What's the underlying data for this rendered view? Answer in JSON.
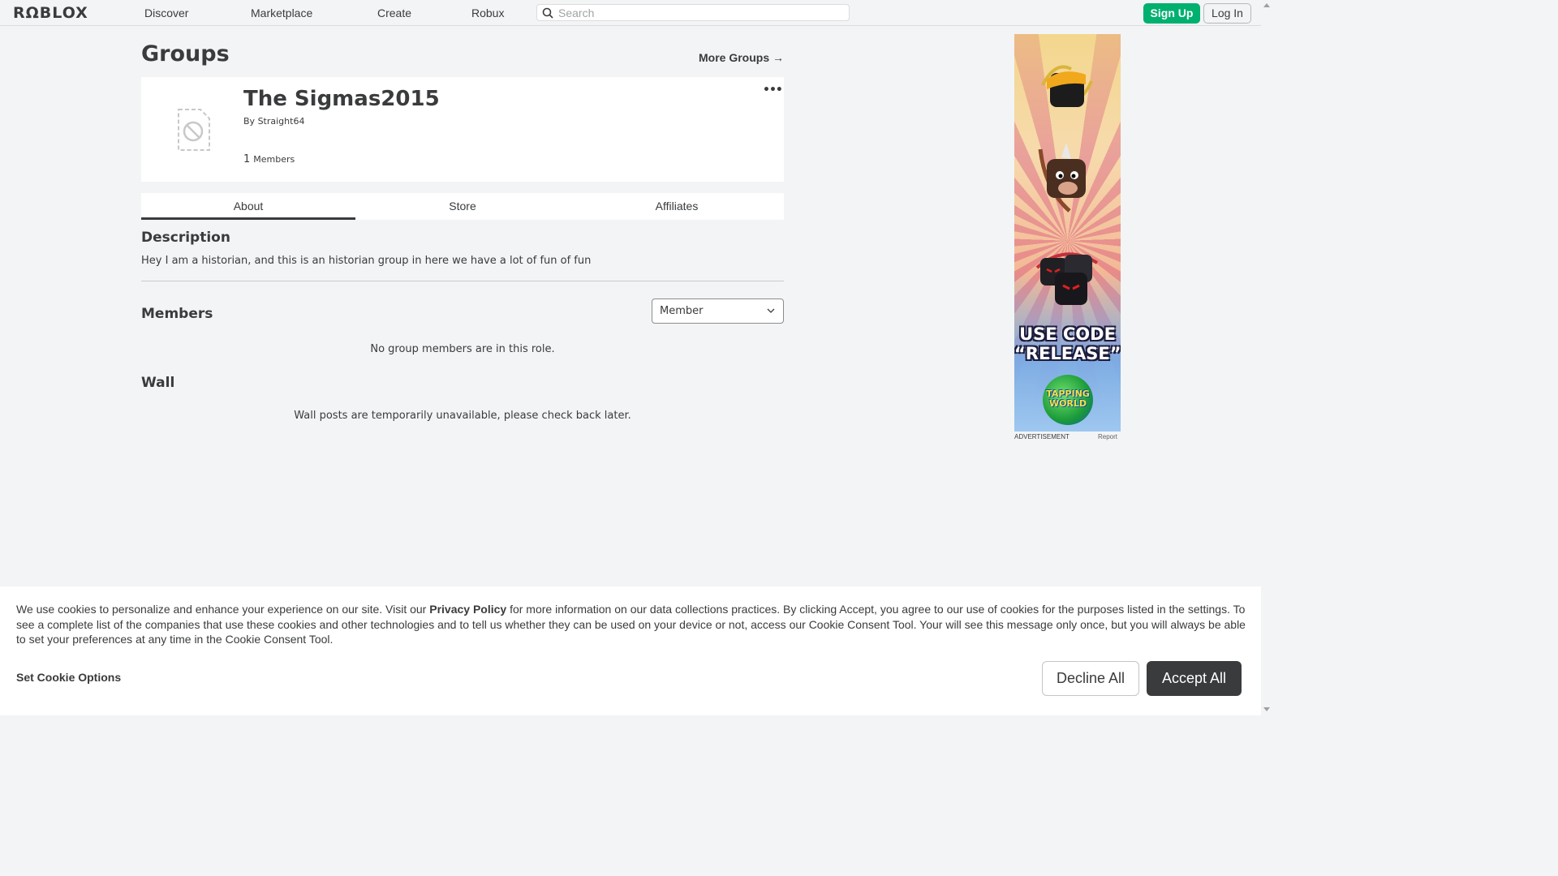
{
  "nav": {
    "logo": "RΩBLOX",
    "links": [
      "Discover",
      "Marketplace",
      "Create",
      "Robux"
    ],
    "search_placeholder": "Search",
    "signup": "Sign Up",
    "login": "Log In"
  },
  "page": {
    "title": "Groups",
    "more_groups": "More Groups →"
  },
  "group": {
    "name": "The Sigmas2015",
    "by_label": "By",
    "owner": "Straight64",
    "member_count": "1",
    "members_label": "Members",
    "more_icon": "ellipsis-icon"
  },
  "tabs": [
    "About",
    "Store",
    "Affiliates"
  ],
  "active_tab": "About",
  "description": {
    "heading": "Description",
    "text": "Hey I am a historian, and this is an historian group in here we have a lot of fun of fun"
  },
  "members": {
    "heading": "Members",
    "role_selected": "Member",
    "empty": "No group members are in this role."
  },
  "wall": {
    "heading": "Wall",
    "empty": "Wall posts are temporarily unavailable, please check back later."
  },
  "ad": {
    "headline_1": "USE CODE",
    "headline_2": "“RELEASE”",
    "logo_text_1": "TAPPING",
    "logo_text_2": "WORLD",
    "label": "ADVERTISEMENT",
    "report": "Report"
  },
  "cookie": {
    "text_1": "We use cookies to personalize and enhance your experience on our site. Visit our ",
    "privacy_link": "Privacy Policy",
    "text_2": " for more information on our data collections practices. By clicking Accept, you agree to our use of cookies for the purposes listed in the settings. To see a complete list of the companies that use these cookies and other technologies and to tell us whether they can be used on your device or not, access our Cookie Consent Tool. Your will see this message only once, but you will always be able to set your preferences at any time in the Cookie Consent Tool.",
    "set_options": "Set Cookie Options",
    "decline": "Decline All",
    "accept": "Accept All"
  }
}
